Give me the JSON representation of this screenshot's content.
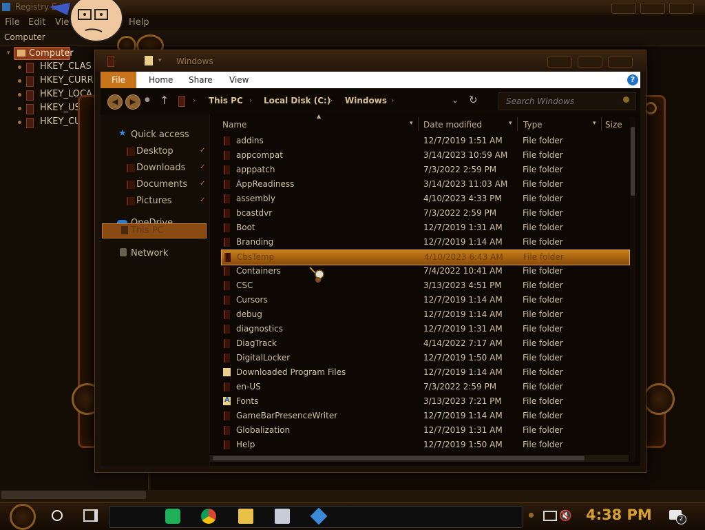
{
  "registry": {
    "title": "Registry Edit",
    "menu": [
      "File",
      "Edit",
      "View",
      "Help"
    ],
    "address": "Computer",
    "tree_root": "Computer",
    "tree_items": [
      "HKEY_CLAS",
      "HKEY_CURR",
      "HKEY_LOCA",
      "HKEY_USE",
      "HKEY_CURR"
    ]
  },
  "explorer": {
    "title": "Windows",
    "ribbon_tabs": {
      "file": "File",
      "home": "Home",
      "share": "Share",
      "view": "View"
    },
    "help": "?",
    "breadcrumbs": [
      "This PC",
      "Local Disk (C:)",
      "Windows"
    ],
    "search_placeholder": "Search Windows",
    "nav": {
      "quick_access": "Quick access",
      "desktop": "Desktop",
      "downloads": "Downloads",
      "documents": "Documents",
      "pictures": "Pictures",
      "onedrive": "OneDrive",
      "this_pc": "This PC",
      "network": "Network"
    },
    "columns": {
      "name": "Name",
      "date": "Date modified",
      "type": "Type",
      "size": "Size"
    },
    "files": [
      {
        "name": "addins",
        "date": "12/7/2019 1:51 AM",
        "type": "File folder",
        "icon": "folder"
      },
      {
        "name": "appcompat",
        "date": "3/14/2023 10:59 AM",
        "type": "File folder",
        "icon": "folder"
      },
      {
        "name": "apppatch",
        "date": "7/3/2022 2:59 PM",
        "type": "File folder",
        "icon": "folder"
      },
      {
        "name": "AppReadiness",
        "date": "3/14/2023 11:03 AM",
        "type": "File folder",
        "icon": "folder"
      },
      {
        "name": "assembly",
        "date": "4/10/2023 4:33 PM",
        "type": "File folder",
        "icon": "folder"
      },
      {
        "name": "bcastdvr",
        "date": "7/3/2022 2:59 PM",
        "type": "File folder",
        "icon": "folder"
      },
      {
        "name": "Boot",
        "date": "12/7/2019 1:31 AM",
        "type": "File folder",
        "icon": "folder"
      },
      {
        "name": "Branding",
        "date": "12/7/2019 1:14 AM",
        "type": "File folder",
        "icon": "folder"
      },
      {
        "name": "CbsTemp",
        "date": "4/10/2023 6:43 AM",
        "type": "File folder",
        "icon": "folder",
        "selected": true
      },
      {
        "name": "Containers",
        "date": "7/4/2022 10:41 AM",
        "type": "File folder",
        "icon": "folder"
      },
      {
        "name": "CSC",
        "date": "3/13/2023 4:51 PM",
        "type": "File folder",
        "icon": "folder"
      },
      {
        "name": "Cursors",
        "date": "12/7/2019 1:14 AM",
        "type": "File folder",
        "icon": "folder"
      },
      {
        "name": "debug",
        "date": "12/7/2019 1:14 AM",
        "type": "File folder",
        "icon": "folder"
      },
      {
        "name": "diagnostics",
        "date": "12/7/2019 1:31 AM",
        "type": "File folder",
        "icon": "folder"
      },
      {
        "name": "DiagTrack",
        "date": "4/14/2022 7:17 AM",
        "type": "File folder",
        "icon": "folder"
      },
      {
        "name": "DigitalLocker",
        "date": "12/7/2019 1:50 AM",
        "type": "File folder",
        "icon": "folder"
      },
      {
        "name": "Downloaded Program Files",
        "date": "12/7/2019 1:14 AM",
        "type": "File folder",
        "icon": "yellow-folder"
      },
      {
        "name": "en-US",
        "date": "7/3/2022 2:59 PM",
        "type": "File folder",
        "icon": "folder"
      },
      {
        "name": "Fonts",
        "date": "3/13/2023 7:21 PM",
        "type": "File folder",
        "icon": "fonts-folder"
      },
      {
        "name": "GameBarPresenceWriter",
        "date": "12/7/2019 1:14 AM",
        "type": "File folder",
        "icon": "folder"
      },
      {
        "name": "Globalization",
        "date": "12/7/2019 1:31 AM",
        "type": "File folder",
        "icon": "folder"
      },
      {
        "name": "Help",
        "date": "12/7/2019 1:50 AM",
        "type": "File folder",
        "icon": "folder"
      }
    ]
  },
  "taskbar": {
    "time": "4:38 PM",
    "notification_count": "2",
    "pinned": [
      "start-gear-icon",
      "search-circle-icon",
      "task-view-icon",
      "sheets-icon",
      "chrome-icon",
      "file-explorer-icon",
      "computer-icon",
      "network-app-icon"
    ]
  },
  "colors": {
    "accent": "#c8801a",
    "background": "#1c1309",
    "clock": "#d8a030"
  }
}
